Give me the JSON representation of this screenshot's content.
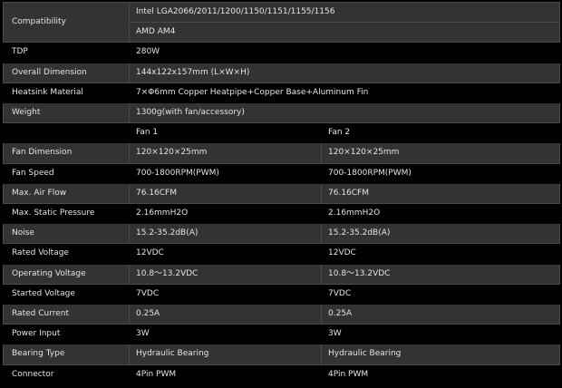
{
  "table": {
    "compatibility": {
      "label": "Compatibility",
      "line1": "Intel LGA2066/2011/1200/1150/1151/1155/1156",
      "line2": "AMD AM4"
    },
    "heatsink_rows": [
      {
        "label": "TDP",
        "value": "280W"
      },
      {
        "label": "Overall Dimension",
        "value": "144x122x157mm (L×W×H)"
      },
      {
        "label": "Heatsink Material",
        "value": "7×Φ6mm Copper Heatpipe+Copper Base+Aluminum Fin"
      },
      {
        "label": "Weight",
        "value": "1300g(with fan/accessory)"
      }
    ],
    "fan_headers": {
      "corner": "",
      "fan1": "Fan 1",
      "fan2": "Fan 2"
    },
    "fan_rows": [
      {
        "label": "Fan Dimension",
        "fan1": "120×120×25mm",
        "fan2": "120×120×25mm"
      },
      {
        "label": "Fan Speed",
        "fan1": "700-1800RPM(PWM)",
        "fan2": "700-1800RPM(PWM)"
      },
      {
        "label": "Max. Air Flow",
        "fan1": "76.16CFM",
        "fan2": "76.16CFM"
      },
      {
        "label": "Max. Static Pressure",
        "fan1": "2.16mmH2O",
        "fan2": "2.16mmH2O"
      },
      {
        "label": "Noise",
        "fan1": "15.2-35.2dB(A)",
        "fan2": "15.2-35.2dB(A)"
      },
      {
        "label": "Rated Voltage",
        "fan1": "12VDC",
        "fan2": "12VDC"
      },
      {
        "label": "Operating Voltage",
        "fan1": "10.8～13.2VDC",
        "fan2": "10.8～13.2VDC"
      },
      {
        "label": "Started Voltage",
        "fan1": "7VDC",
        "fan2": "7VDC"
      },
      {
        "label": "Rated Current",
        "fan1": "0.25A",
        "fan2": "0.25A"
      },
      {
        "label": "Power Input",
        "fan1": "3W",
        "fan2": "3W"
      },
      {
        "label": "Bearing Type",
        "fan1": "Hydraulic Bearing",
        "fan2": "Hydraulic Bearing"
      },
      {
        "label": "Connector",
        "fan1": "4Pin PWM",
        "fan2": "4Pin PWM"
      }
    ]
  },
  "colors": {
    "shaded_row": "#333333",
    "plain_row": "#000000",
    "text": "#e4e4e4"
  }
}
